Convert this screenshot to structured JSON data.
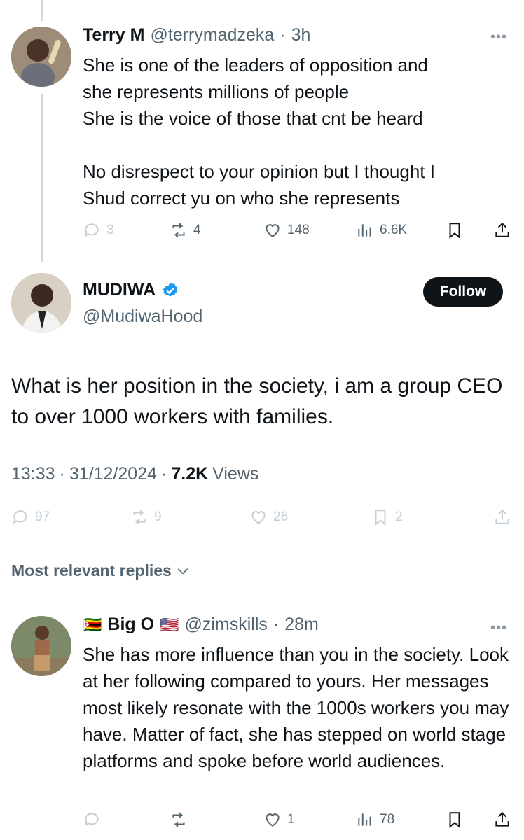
{
  "tweet1": {
    "name": "Terry M",
    "handle": "@terrymadzeka",
    "time": "3h",
    "text": "She is one of the leaders of opposition and\nshe represents millions of people\nShe is the voice of those that cnt be heard\n\nNo disrespect to your opinion but I thought I\nShud correct yu on who she represents",
    "replies": "3",
    "retweets": "4",
    "likes": "148",
    "views": "6.6K"
  },
  "main": {
    "name": "MUDIWA",
    "handle": "@MudiwaHood",
    "follow_label": "Follow",
    "text": "What is her position in the society, i am a group CEO to over 1000 workers with families.",
    "time": "13:33",
    "date": "31/12/2024",
    "views_count": "7.2K",
    "views_label": "Views",
    "replies": "97",
    "retweets": "9",
    "likes": "26",
    "bookmarks": "2"
  },
  "replies_sort": {
    "label": "Most relevant replies"
  },
  "tweet2": {
    "flag_prefix": "🇿🇼",
    "name": "Big O",
    "flag_suffix": "🇺🇸",
    "handle": "@zimskills",
    "time": "28m",
    "text": "She has more influence than you in the society. Look at her following compared to yours. Her messages most likely resonate with the 1000s workers you may have. Matter of fact, she has stepped on world stage platforms and spoke before world audiences.",
    "replies": "",
    "retweets": "",
    "likes": "1",
    "views": "78"
  },
  "colors": {
    "text": "#0f1419",
    "secondary": "#536471",
    "faded": "#aab8c2",
    "verified": "#1d9bf0",
    "follow_bg": "#0f1419"
  }
}
